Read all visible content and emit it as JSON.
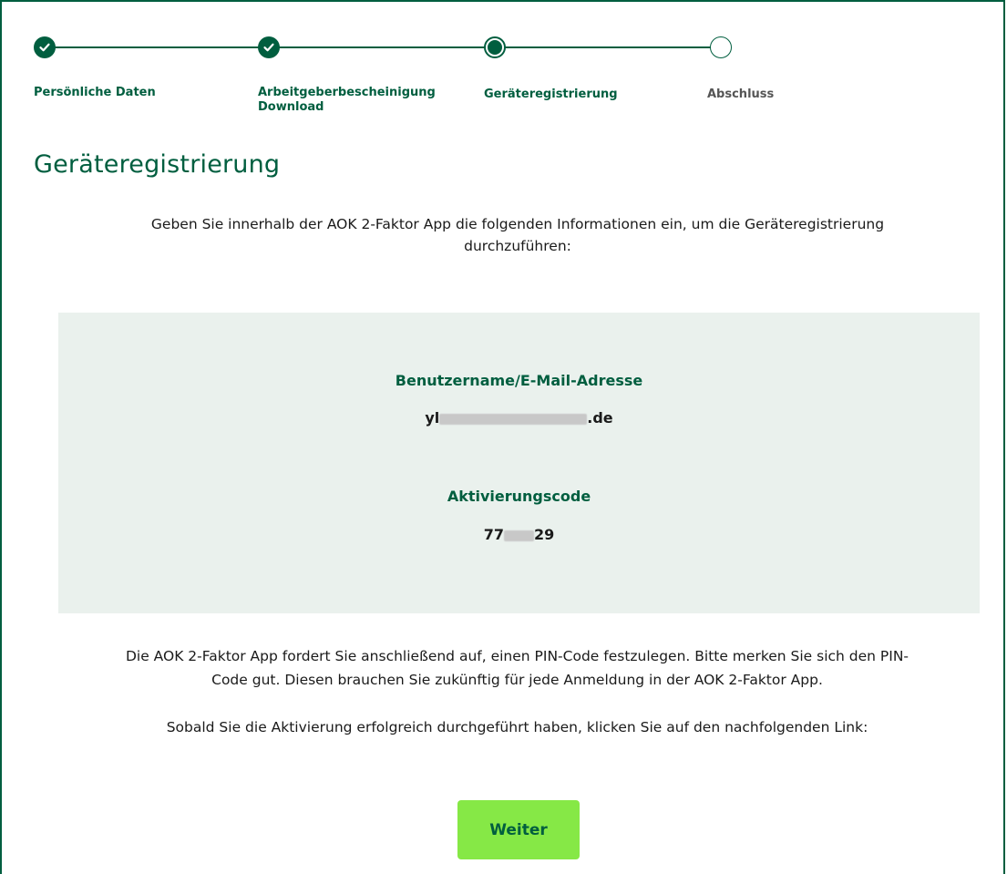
{
  "stepper": {
    "steps": [
      {
        "label_line1": "Persönliche Daten",
        "label_line2": "",
        "state": "done"
      },
      {
        "label_line1": "Arbeitgeberbescheinigung",
        "label_line2": "Download",
        "state": "done"
      },
      {
        "label_line1": "Geräteregistrierung",
        "label_line2": "",
        "state": "current"
      },
      {
        "label_line1": "Abschluss",
        "label_line2": "",
        "state": "pending"
      }
    ]
  },
  "page": {
    "title": "Geräteregistrierung",
    "intro_line1": "Geben Sie innerhalb der AOK 2-Faktor App die folgenden Informationen ein, um die Geräteregistrierung",
    "intro_line2": "durchzuführen:"
  },
  "info": {
    "username_label": "Benutzername/E-Mail-Adresse",
    "username_prefix": "yl",
    "username_suffix": ".de",
    "code_label": "Aktivierungscode",
    "code_prefix": "77",
    "code_suffix": "29"
  },
  "outro": {
    "line1": "Die AOK 2-Faktor App fordert Sie anschließend auf, einen PIN-Code festzulegen. Bitte merken Sie sich den PIN-",
    "line2": "Code gut. Diesen brauchen Sie zukünftig für jede Anmeldung in der AOK 2-Faktor App.",
    "line3": "Sobald Sie die Aktivierung erfolgreich durchgeführt haben, klicken Sie auf den nachfolgenden Link:"
  },
  "actions": {
    "next_label": "Weiter"
  },
  "colors": {
    "brand_green": "#005e3f",
    "button_green": "#86e846",
    "info_bg": "#eaf1ed"
  }
}
